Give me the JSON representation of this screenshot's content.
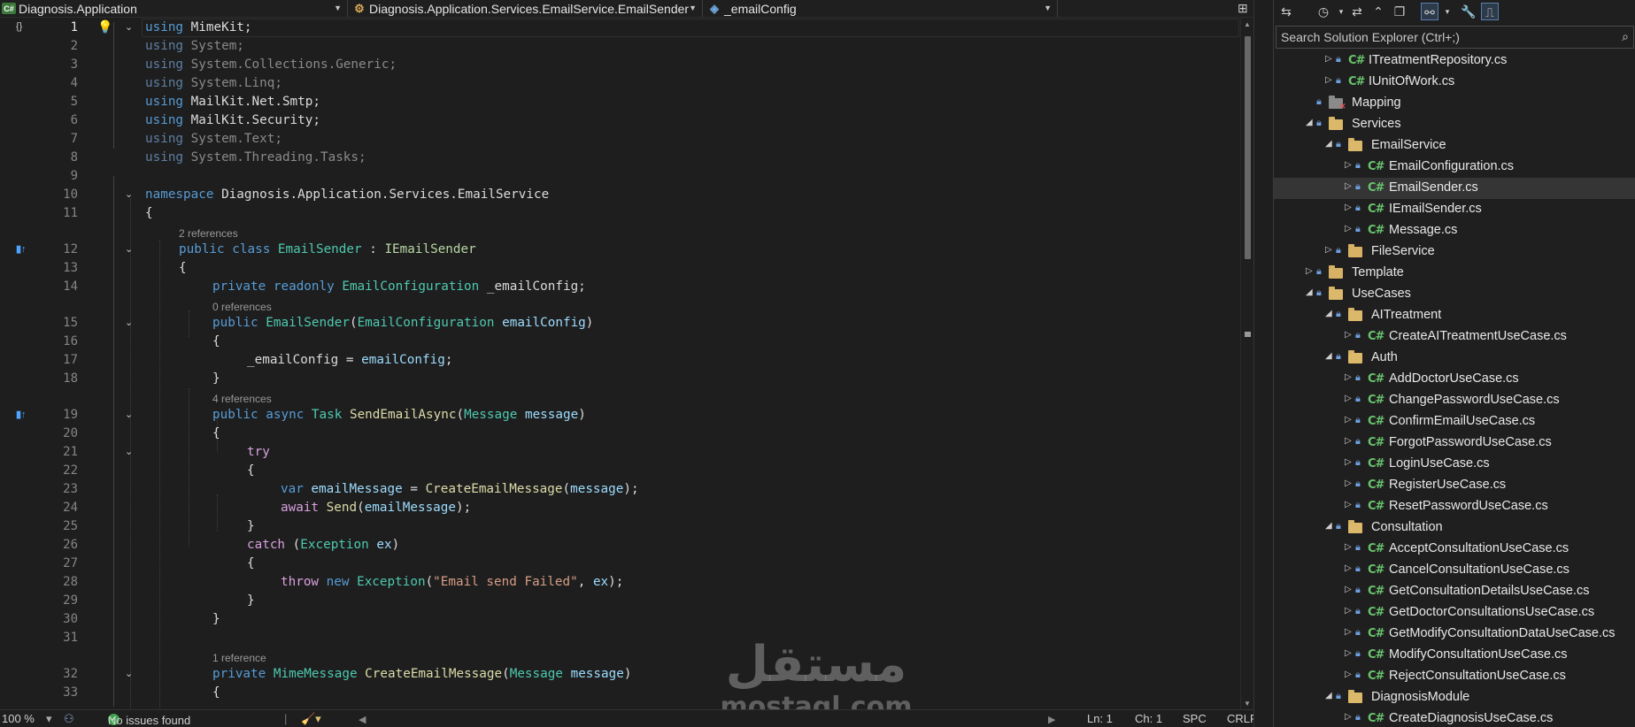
{
  "navbar": {
    "project": "Diagnosis.Application",
    "type": "Diagnosis.Application.Services.EmailService.EmailSender",
    "member": "_emailConfig",
    "project_icon": "csharp-project-icon",
    "type_icon": "class-icon",
    "member_icon": "field-icon"
  },
  "editor": {
    "current_line": 1,
    "line_numbers": [
      "1",
      "2",
      "3",
      "4",
      "5",
      "6",
      "7",
      "8",
      "9",
      "10",
      "11",
      "12",
      "13",
      "14",
      "15",
      "16",
      "17",
      "18",
      "19",
      "20",
      "21",
      "22",
      "23",
      "24",
      "25",
      "26",
      "27",
      "28",
      "29",
      "30",
      "31",
      "32",
      "33"
    ],
    "code_lens": {
      "class_refs": "2 references",
      "ctor_refs": "0 references",
      "send_refs": "4 references",
      "create_refs": "1 reference"
    },
    "code": {
      "l1_a": "using",
      "l1_b": " MimeKit;",
      "l2_a": "using",
      "l2_b": " System;",
      "l3_a": "using",
      "l3_b": " System.Collections.Generic;",
      "l4_a": "using",
      "l4_b": " System.Linq;",
      "l5_a": "using",
      "l5_b": " MailKit.Net.Smtp;",
      "l6_a": "using",
      "l6_b": " MailKit.Security;",
      "l7_a": "using",
      "l7_b": " System.Text;",
      "l8_a": "using",
      "l8_b": " System.Threading.Tasks;",
      "l10_a": "namespace",
      "l10_b": " Diagnosis.Application.Services.EmailService",
      "l11": "{",
      "l12_a": "public",
      "l12_b": " class",
      "l12_c": " EmailSender",
      "l12_d": " : ",
      "l12_e": "IEmailSender",
      "l13": "{",
      "l14_a": "private",
      "l14_b": " readonly",
      "l14_c": " EmailConfiguration",
      "l14_d": " _emailConfig;",
      "l15_a": "public",
      "l15_b": " EmailSender",
      "l15_c": "(",
      "l15_d": "EmailConfiguration",
      "l15_e": " emailConfig",
      "l15_f": ")",
      "l16": "{",
      "l17_a": "_emailConfig = ",
      "l17_b": "emailConfig",
      "l17_c": ";",
      "l18": "}",
      "l19_a": "public",
      "l19_b": " async",
      "l19_c": " Task",
      "l19_d": " SendEmailAsync",
      "l19_e": "(",
      "l19_f": "Message",
      "l19_g": " message",
      "l19_h": ")",
      "l20": "{",
      "l21": "try",
      "l22": "{",
      "l23_a": "var",
      "l23_b": " emailMessage",
      "l23_c": " = ",
      "l23_d": "CreateEmailMessage",
      "l23_e": "(",
      "l23_f": "message",
      "l23_g": ");",
      "l24_a": "await",
      "l24_b": " Send",
      "l24_c": "(",
      "l24_d": "emailMessage",
      "l24_e": ");",
      "l25": "}",
      "l26_a": "catch",
      "l26_b": " (",
      "l26_c": "Exception",
      "l26_d": " ex",
      "l26_e": ")",
      "l27": "{",
      "l28_a": "throw",
      "l28_b": " new",
      "l28_c": " Exception",
      "l28_d": "(",
      "l28_e": "\"Email send Failed\"",
      "l28_f": ", ",
      "l28_g": "ex",
      "l28_h": ");",
      "l29": "}",
      "l30": "}",
      "l32_a": "private",
      "l32_b": " MimeMessage",
      "l32_c": " CreateEmailMessage",
      "l32_d": "(",
      "l32_e": "Message",
      "l32_f": " message",
      "l32_g": ")",
      "l33": "{"
    }
  },
  "statusbar": {
    "zoom": "100 %",
    "issues": "No issues found",
    "ln": "Ln: 1",
    "ch": "Ch: 1",
    "spc": "SPC",
    "crlf": "CRLF"
  },
  "solution_explorer": {
    "search_placeholder": "Search Solution Explorer (Ctrl+;)",
    "items": [
      {
        "label": "ITreatmentRepository.cs",
        "kind": "cs"
      },
      {
        "label": "IUnitOfWork.cs",
        "kind": "cs"
      },
      {
        "label": "Mapping",
        "kind": "folder-excluded"
      },
      {
        "label": "Services",
        "kind": "folder-open"
      },
      {
        "label": "EmailService",
        "kind": "folder-open"
      },
      {
        "label": "EmailConfiguration.cs",
        "kind": "cs"
      },
      {
        "label": "EmailSender.cs",
        "kind": "cs",
        "selected": true
      },
      {
        "label": "IEmailSender.cs",
        "kind": "cs"
      },
      {
        "label": "Message.cs",
        "kind": "cs"
      },
      {
        "label": "FileService",
        "kind": "folder"
      },
      {
        "label": "Template",
        "kind": "folder"
      },
      {
        "label": "UseCases",
        "kind": "folder-open"
      },
      {
        "label": "AITreatment",
        "kind": "folder-open"
      },
      {
        "label": "CreateAITreatmentUseCase.cs",
        "kind": "cs"
      },
      {
        "label": "Auth",
        "kind": "folder-open"
      },
      {
        "label": "AddDoctorUseCase.cs",
        "kind": "cs"
      },
      {
        "label": "ChangePasswordUseCase.cs",
        "kind": "cs"
      },
      {
        "label": "ConfirmEmailUseCase.cs",
        "kind": "cs"
      },
      {
        "label": "ForgotPasswordUseCase.cs",
        "kind": "cs"
      },
      {
        "label": "LoginUseCase.cs",
        "kind": "cs"
      },
      {
        "label": "RegisterUseCase.cs",
        "kind": "cs"
      },
      {
        "label": "ResetPasswordUseCase.cs",
        "kind": "cs"
      },
      {
        "label": "Consultation",
        "kind": "folder-open"
      },
      {
        "label": "AcceptConsultationUseCase.cs",
        "kind": "cs"
      },
      {
        "label": "CancelConsultationUseCase.cs",
        "kind": "cs"
      },
      {
        "label": "GetConsultationDetailsUseCase.cs",
        "kind": "cs"
      },
      {
        "label": "GetDoctorConsultationsUseCase.cs",
        "kind": "cs"
      },
      {
        "label": "GetModifyConsultationDataUseCase.cs",
        "kind": "cs"
      },
      {
        "label": "ModifyConsultationUseCase.cs",
        "kind": "cs"
      },
      {
        "label": "RejectConsultationUseCase.cs",
        "kind": "cs"
      },
      {
        "label": "DiagnosisModule",
        "kind": "folder-open"
      },
      {
        "label": "CreateDiagnosisUseCase.cs",
        "kind": "cs"
      }
    ]
  },
  "watermark": {
    "arabic": "مستقل",
    "latin": "mostaql.com"
  },
  "colors": {
    "keyword": "#569cd6",
    "control": "#d8a0df",
    "type": "#4ec9b0",
    "method": "#dcdcaa",
    "variable": "#9cdcfe",
    "string": "#d69d85",
    "background": "#1e1e1e"
  }
}
